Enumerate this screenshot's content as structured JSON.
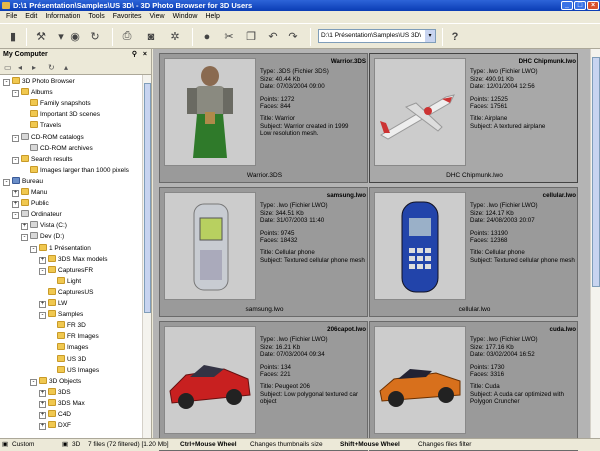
{
  "title": "D:\\1 Présentation\\Samples\\US 3D\\ - 3D Photo Browser for 3D Users",
  "menu": [
    "File",
    "Edit",
    "Information",
    "Tools",
    "Favorites",
    "View",
    "Window",
    "Help"
  ],
  "toolbar": {
    "path": "D:\\1 Présentation\\Samples\\US 3D\\",
    "help_icon": "help-icon"
  },
  "left_panel": {
    "header": "My Computer",
    "tree": [
      {
        "label": "3D Photo Browser",
        "indent": 0,
        "icon": "app",
        "exp": "-"
      },
      {
        "label": "Albums",
        "indent": 1,
        "icon": "folder",
        "exp": "-"
      },
      {
        "label": "Family snapshots",
        "indent": 2,
        "icon": "folder",
        "exp": ""
      },
      {
        "label": "Important 3D scenes",
        "indent": 2,
        "icon": "folder",
        "exp": ""
      },
      {
        "label": "Travels",
        "indent": 2,
        "icon": "folder",
        "exp": ""
      },
      {
        "label": "CD-ROM catalogs",
        "indent": 1,
        "icon": "cd",
        "exp": "-"
      },
      {
        "label": "CD-ROM archives",
        "indent": 2,
        "icon": "cd",
        "exp": ""
      },
      {
        "label": "Search results",
        "indent": 1,
        "icon": "folder",
        "exp": "-"
      },
      {
        "label": "Images larger than 1000 pixels",
        "indent": 2,
        "icon": "folder",
        "exp": ""
      },
      {
        "label": "Bureau",
        "indent": 0,
        "icon": "desktop",
        "exp": "-"
      },
      {
        "label": "Manu",
        "indent": 1,
        "icon": "folder",
        "exp": "+"
      },
      {
        "label": "Public",
        "indent": 1,
        "icon": "folder",
        "exp": "+"
      },
      {
        "label": "Ordinateur",
        "indent": 1,
        "icon": "computer",
        "exp": "-"
      },
      {
        "label": "Vista (C:)",
        "indent": 2,
        "icon": "drive",
        "exp": "+"
      },
      {
        "label": "Dev (D:)",
        "indent": 2,
        "icon": "drive",
        "exp": "-"
      },
      {
        "label": "1 Présentation",
        "indent": 3,
        "icon": "folder",
        "exp": "-"
      },
      {
        "label": "3DS Max models",
        "indent": 4,
        "icon": "folder",
        "exp": "+"
      },
      {
        "label": "CapturesFR",
        "indent": 4,
        "icon": "folder",
        "exp": "-"
      },
      {
        "label": "Light",
        "indent": 5,
        "icon": "folder",
        "exp": ""
      },
      {
        "label": "CapturesUS",
        "indent": 4,
        "icon": "folder",
        "exp": ""
      },
      {
        "label": "LW",
        "indent": 4,
        "icon": "folder",
        "exp": "+"
      },
      {
        "label": "Samples",
        "indent": 4,
        "icon": "folder",
        "exp": "-"
      },
      {
        "label": "FR 3D",
        "indent": 5,
        "icon": "folder",
        "exp": ""
      },
      {
        "label": "FR Images",
        "indent": 5,
        "icon": "folder",
        "exp": ""
      },
      {
        "label": "Images",
        "indent": 5,
        "icon": "folder",
        "exp": ""
      },
      {
        "label": "US 3D",
        "indent": 5,
        "icon": "folder",
        "exp": ""
      },
      {
        "label": "US Images",
        "indent": 5,
        "icon": "folder",
        "exp": ""
      },
      {
        "label": "3D Objects",
        "indent": 3,
        "icon": "folder",
        "exp": "-"
      },
      {
        "label": "3DS",
        "indent": 4,
        "icon": "folder",
        "exp": "+"
      },
      {
        "label": "3DS Max",
        "indent": 4,
        "icon": "folder",
        "exp": "+"
      },
      {
        "label": "C4D",
        "indent": 4,
        "icon": "folder",
        "exp": "+"
      },
      {
        "label": "DXF",
        "indent": 4,
        "icon": "folder",
        "exp": "+"
      }
    ]
  },
  "cards": [
    {
      "name": "Warrior.3DS",
      "type": "Type: .3DS (Fichier 3DS)",
      "size": "Size: 40.44 Kb",
      "date": "Date: 07/03/2004 09:00",
      "points": "Points: 1272",
      "faces": "Faces: 844",
      "title": "Title: Warrior",
      "subject": "Subject: Warrior created in 1999",
      "extra": "Low resolution mesh.",
      "caption": "Warrior.3DS",
      "thumb": "warrior",
      "selected": false
    },
    {
      "name": "DHC Chipmunk.lwo",
      "type": "Type: .lwo (Fichier LWO)",
      "size": "Size: 490.91 Kb",
      "date": "Date: 12/01/2004 12:56",
      "points": "Points: 12525",
      "faces": "Faces: 17561",
      "title": "Title: Airplane",
      "subject": "Subject: A textured airplane",
      "extra": "",
      "caption": "DHC Chipmunk.lwo",
      "thumb": "plane",
      "selected": true
    },
    {
      "name": "samsung.lwo",
      "type": "Type: .lwo (Fichier LWO)",
      "size": "Size: 344.51 Kb",
      "date": "Date: 31/07/2003 11:40",
      "points": "Points: 9745",
      "faces": "Faces: 18432",
      "title": "Title: Cellular phone",
      "subject": "Subject: Textured cellular phone mesh",
      "extra": "",
      "caption": "samsung.lwo",
      "thumb": "phone1",
      "selected": false
    },
    {
      "name": "cellular.lwo",
      "type": "Type: .lwo (Fichier LWO)",
      "size": "Size: 124.17 Kb",
      "date": "Date: 24/08/2003 20:07",
      "points": "Points: 13190",
      "faces": "Faces: 12368",
      "title": "Title: Cellular phone",
      "subject": "Subject: Textured cellular phone mesh",
      "extra": "",
      "caption": "cellular.lwo",
      "thumb": "phone2",
      "selected": false
    },
    {
      "name": "206capot.lwo",
      "type": "Type: .lwo (Fichier LWO)",
      "size": "Size: 16.21 Kb",
      "date": "Date: 07/03/2004 09:34",
      "points": "Points: 134",
      "faces": "Faces: 221",
      "title": "Title: Peugeot 206",
      "subject": "Subject: Low polygonal textured car object",
      "extra": "",
      "caption": "",
      "thumb": "car1",
      "selected": false
    },
    {
      "name": "cuda.lwo",
      "type": "Type: .lwo (Fichier LWO)",
      "size": "Size: 177.16 Kb",
      "date": "Date: 03/02/2004 16:52",
      "points": "Points: 1730",
      "faces": "Faces: 3316",
      "title": "Title: Cuda",
      "subject": "Subject: A cuda car optimized with Polygon Cruncher",
      "extra": "",
      "caption": "",
      "thumb": "car2",
      "selected": false
    }
  ],
  "status": {
    "custom": "Custom",
    "filter": "3D",
    "files": "7 files (72 filtered) [1.20 Mb]",
    "hint1_bold": "Ctrl+Mouse Wheel",
    "hint1": "Changes thumbnails size",
    "hint2_bold": "Shift+Mouse Wheel",
    "hint2": "Changes files filter"
  }
}
